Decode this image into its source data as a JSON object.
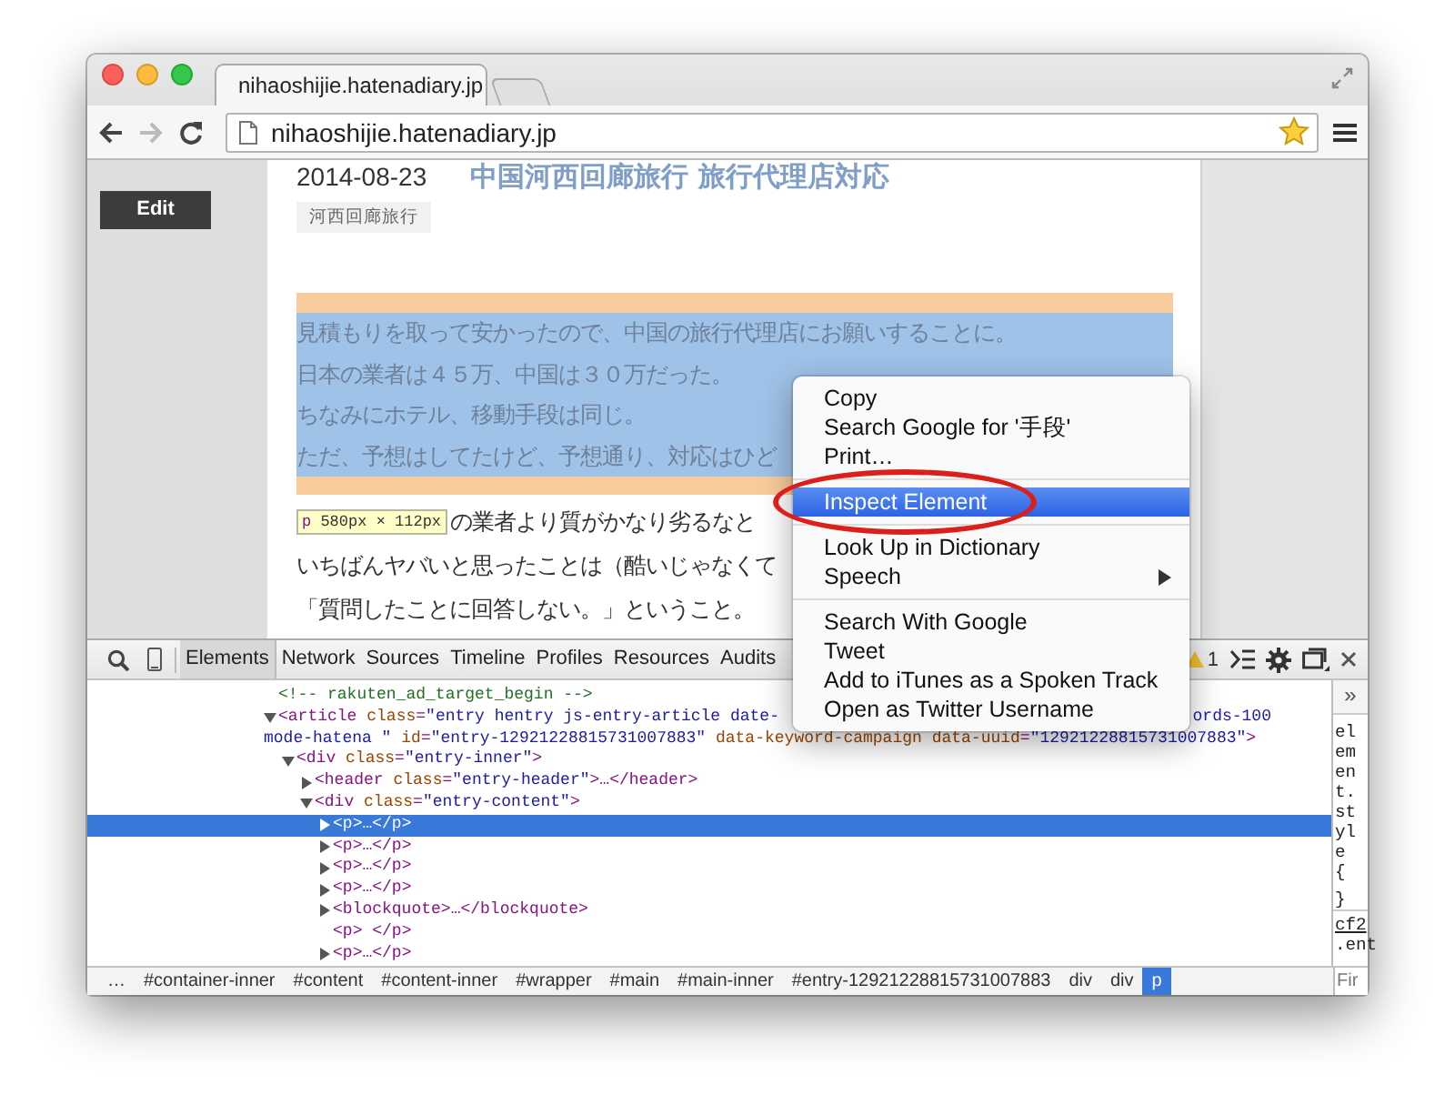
{
  "browser": {
    "tab": {
      "title": "nihaoshijie.hatenadiary.jp"
    },
    "back": {
      "disabled": false
    },
    "forward": {
      "disabled": true
    },
    "address": "nihaoshijie.hatenadiary.jp",
    "bookmarked": true
  },
  "page": {
    "edit_button": "Edit",
    "entry": {
      "date": "2014-08-23",
      "title": "中国河西回廊旅行 旅行代理店対応",
      "category": "河西回廊旅行",
      "highlighted_paragraph": [
        "見積もりを取って安かったので、中国の旅行代理店にお願いすることに。",
        "日本の業者は４５万、中国は３０万だった。",
        "ちなみにホテル、移動手段は同じ。",
        "ただ、予想はしてたけど、予想通り、対応はひど"
      ],
      "inspect_tooltip": {
        "tag": "p",
        "size": "580px × 112px"
      },
      "body_lines": [
        "の業者より質がかなり劣るなと",
        "いちばんヤバいと思ったことは（酷いじゃなくて",
        "「質問したことに回答しない。」ということ。"
      ]
    }
  },
  "context_menu": {
    "groups": [
      [
        {
          "label": "Copy",
          "selected": false,
          "circled": false,
          "submenu": false
        },
        {
          "label": "Search Google for '手段'",
          "selected": false,
          "circled": false,
          "submenu": false
        },
        {
          "label": "Print…",
          "selected": false,
          "circled": false,
          "submenu": false
        }
      ],
      [
        {
          "label": "Inspect Element",
          "selected": true,
          "circled": true,
          "submenu": false
        }
      ],
      [
        {
          "label": "Look Up in Dictionary",
          "selected": false,
          "circled": false,
          "submenu": false
        },
        {
          "label": "Speech",
          "selected": false,
          "circled": false,
          "submenu": true
        }
      ],
      [
        {
          "label": "Search With Google",
          "selected": false,
          "circled": false,
          "submenu": false
        },
        {
          "label": "Tweet",
          "selected": false,
          "circled": false,
          "submenu": false
        },
        {
          "label": "Add to iTunes as a Spoken Track",
          "selected": false,
          "circled": false,
          "submenu": false
        },
        {
          "label": "Open as Twitter Username",
          "selected": false,
          "circled": false,
          "submenu": false
        }
      ]
    ]
  },
  "devtools": {
    "tabs": [
      {
        "label": "Elements",
        "selected": true
      },
      {
        "label": "Network",
        "selected": false
      },
      {
        "label": "Sources",
        "selected": false
      },
      {
        "label": "Timeline",
        "selected": false
      },
      {
        "label": "Profiles",
        "selected": false
      },
      {
        "label": "Resources",
        "selected": false
      },
      {
        "label": "Audits",
        "selected": false
      }
    ],
    "warning_count": "1",
    "dom_tree": [
      {
        "kind": "comment",
        "text": "<!-- rakuten_ad_target_begin -->",
        "expandable": false,
        "selected": false
      },
      {
        "kind": "element",
        "text": "<article class=\"entry hentry js-entry-article date-",
        "text_tail": "ords-100",
        "continuation": "mode-hatena \" id=\"entry-12921228815731007883\" data-keyword-campaign data-uuid=\"12921228815731007883\">",
        "expandable": true,
        "expanded": true,
        "selected": false,
        "children": [
          {
            "kind": "element",
            "text": "<div class=\"entry-inner\">",
            "expandable": true,
            "expanded": true,
            "selected": false,
            "children": [
              {
                "kind": "element",
                "text": "<header class=\"entry-header\">…</header>",
                "expandable": true,
                "expanded": false,
                "selected": false
              },
              {
                "kind": "element",
                "text": "<div class=\"entry-content\">",
                "expandable": true,
                "expanded": true,
                "selected": false,
                "children": [
                  {
                    "kind": "element",
                    "text": "<p>…</p>",
                    "expandable": true,
                    "expanded": false,
                    "selected": true
                  },
                  {
                    "kind": "element",
                    "text": "<p>…</p>",
                    "expandable": true,
                    "expanded": false,
                    "selected": false
                  },
                  {
                    "kind": "element",
                    "text": "<p>…</p>",
                    "expandable": true,
                    "expanded": false,
                    "selected": false
                  },
                  {
                    "kind": "element",
                    "text": "<p>…</p>",
                    "expandable": true,
                    "expanded": false,
                    "selected": false
                  },
                  {
                    "kind": "element",
                    "text": "<blockquote>…</blockquote>",
                    "expandable": true,
                    "expanded": false,
                    "selected": false
                  },
                  {
                    "kind": "element",
                    "text": "<p>  </p>",
                    "expandable": false,
                    "selected": false
                  },
                  {
                    "kind": "element",
                    "text": "<p>…</p>",
                    "expandable": true,
                    "expanded": false,
                    "selected": false
                  }
                ]
              }
            ]
          }
        ]
      }
    ],
    "styles_pane": {
      "toggle": "»",
      "rule": "element.style {",
      "rule_end": "}",
      "source_link": "cf2",
      "selector": ".ent",
      "filter_placeholder": "Fir"
    },
    "breadcrumbs": [
      {
        "label": "…",
        "selected": false
      },
      {
        "label": "#container-inner",
        "selected": false
      },
      {
        "label": "#content",
        "selected": false
      },
      {
        "label": "#content-inner",
        "selected": false
      },
      {
        "label": "#wrapper",
        "selected": false
      },
      {
        "label": "#main",
        "selected": false
      },
      {
        "label": "#main-inner",
        "selected": false
      },
      {
        "label": "#entry-12921228815731007883",
        "selected": false
      },
      {
        "label": "div",
        "selected": false
      },
      {
        "label": "div",
        "selected": false
      },
      {
        "label": "p",
        "selected": true
      }
    ]
  }
}
